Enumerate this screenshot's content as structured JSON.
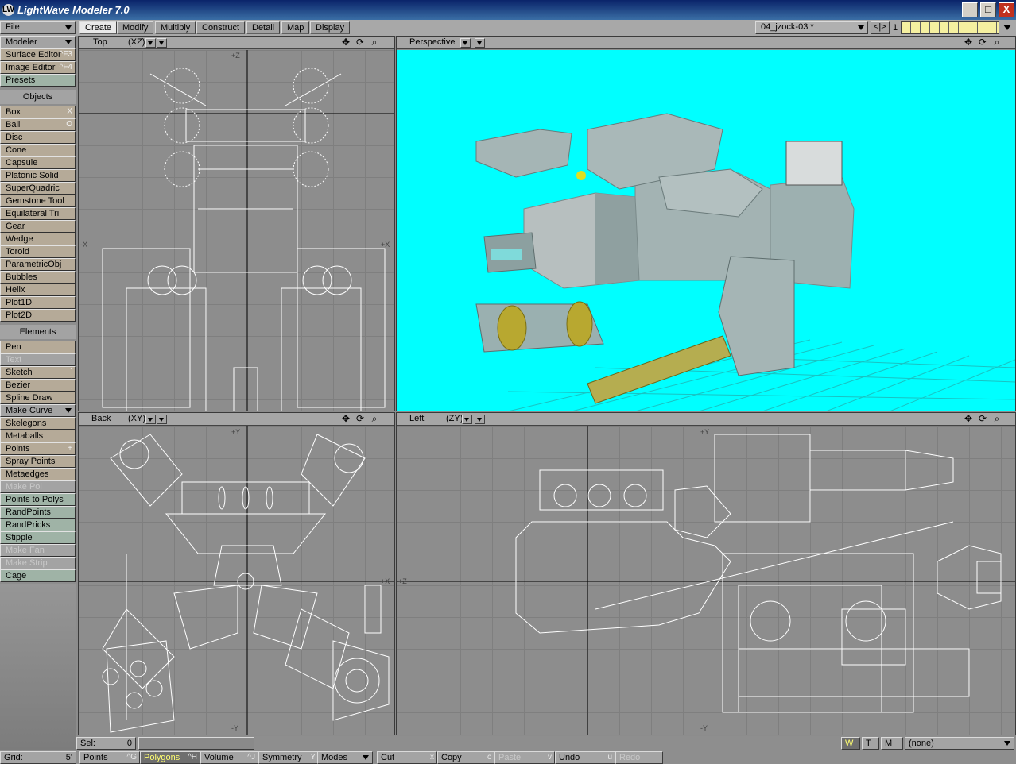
{
  "window": {
    "title": "LightWave Modeler 7.0",
    "minimize": "_",
    "maximize": "□",
    "close": "X"
  },
  "tabs": [
    "Create",
    "Modify",
    "Multiply",
    "Construct",
    "Detail",
    "Map",
    "Display"
  ],
  "active_tab": "Create",
  "topright": {
    "layer_object": "04_jzock-03 *",
    "layer_num": "1",
    "nav": "<|>"
  },
  "sidebar": {
    "file": "File",
    "modeler": "Modeler",
    "surface_editor": {
      "label": "Surface Editor",
      "shortcut": "^F3"
    },
    "image_editor": {
      "label": "Image Editor",
      "shortcut": "^F4"
    },
    "presets": "Presets",
    "objects_header": "Objects",
    "objects": [
      {
        "label": "Box",
        "shortcut": "X"
      },
      {
        "label": "Ball",
        "shortcut": "O"
      },
      {
        "label": "Disc",
        "shortcut": ""
      },
      {
        "label": "Cone",
        "shortcut": ""
      },
      {
        "label": "Capsule",
        "shortcut": ""
      },
      {
        "label": "Platonic Solid",
        "shortcut": ""
      },
      {
        "label": "SuperQuadric",
        "shortcut": ""
      },
      {
        "label": "Gemstone Tool",
        "shortcut": ""
      },
      {
        "label": "Equilateral Tri",
        "shortcut": ""
      },
      {
        "label": "Gear",
        "shortcut": ""
      },
      {
        "label": "Wedge",
        "shortcut": ""
      },
      {
        "label": "Toroid",
        "shortcut": ""
      },
      {
        "label": "ParametricObj",
        "shortcut": ""
      },
      {
        "label": "Bubbles",
        "shortcut": ""
      },
      {
        "label": "Helix",
        "shortcut": ""
      },
      {
        "label": "Plot1D",
        "shortcut": ""
      },
      {
        "label": "Plot2D",
        "shortcut": ""
      }
    ],
    "elements_header": "Elements",
    "elements": [
      {
        "label": "Pen",
        "shortcut": "",
        "style": "tan"
      },
      {
        "label": "Text",
        "shortcut": "",
        "style": "dim"
      },
      {
        "label": "Sketch",
        "shortcut": "`",
        "style": "tan"
      },
      {
        "label": "Bezier",
        "shortcut": "",
        "style": "tan"
      },
      {
        "label": "Spline Draw",
        "shortcut": "",
        "style": "tan"
      },
      {
        "label": "Make Curve",
        "shortcut": "",
        "style": "dropdown"
      },
      {
        "label": "Skelegons",
        "shortcut": "",
        "style": "tan"
      },
      {
        "label": "Metaballs",
        "shortcut": "",
        "style": "tan"
      },
      {
        "label": "Points",
        "shortcut": "+",
        "style": "tan"
      },
      {
        "label": "Spray Points",
        "shortcut": "",
        "style": "tan"
      },
      {
        "label": "Metaedges",
        "shortcut": "",
        "style": "tan"
      },
      {
        "label": "Make Pol",
        "shortcut": "",
        "style": "dim"
      },
      {
        "label": "Points to Polys",
        "shortcut": "",
        "style": "green"
      },
      {
        "label": "RandPoints",
        "shortcut": "",
        "style": "green"
      },
      {
        "label": "RandPricks",
        "shortcut": "",
        "style": "green"
      },
      {
        "label": "Stipple",
        "shortcut": "",
        "style": "green"
      },
      {
        "label": "Make Fan",
        "shortcut": "",
        "style": "dim"
      },
      {
        "label": "Make Strip",
        "shortcut": "",
        "style": "dim"
      },
      {
        "label": "Cage",
        "shortcut": "",
        "style": "green"
      }
    ],
    "grid_label": "Grid:",
    "grid_value": "5'"
  },
  "viewports": {
    "top": {
      "name": "Top",
      "axis": "(XZ)"
    },
    "perspective": {
      "name": "Perspective"
    },
    "back": {
      "name": "Back",
      "axis": "(XY)"
    },
    "left": {
      "name": "Left",
      "axis": "(ZY)"
    }
  },
  "axis_labels": {
    "plus_z": "+Z",
    "minus_x": "-X",
    "plus_x": "+X",
    "plus_y": "+Y",
    "minus_y": "-Y",
    "minus_z": "-Z"
  },
  "status": {
    "sel_label": "Sel:",
    "sel_value": "0",
    "w": "W",
    "t": "T",
    "m": "M",
    "surface": "(none)"
  },
  "bottom": [
    {
      "label": "Points",
      "shortcut": "^G"
    },
    {
      "label": "Polygons",
      "shortcut": "^H"
    },
    {
      "label": "Volume",
      "shortcut": "^J"
    },
    {
      "label": "Symmetry",
      "shortcut": "Y"
    },
    {
      "label": "Modes",
      "shortcut": ""
    },
    {
      "label": "Cut",
      "shortcut": "x"
    },
    {
      "label": "Copy",
      "shortcut": "c"
    },
    {
      "label": "Paste",
      "shortcut": "v"
    },
    {
      "label": "Undo",
      "shortcut": "u"
    },
    {
      "label": "Redo",
      "shortcut": ""
    }
  ],
  "colors": {
    "perspective_bg": "#00ffff",
    "mesh": "#ffffff",
    "model": "#aab5b5",
    "accent_gold": "#b8a830"
  }
}
